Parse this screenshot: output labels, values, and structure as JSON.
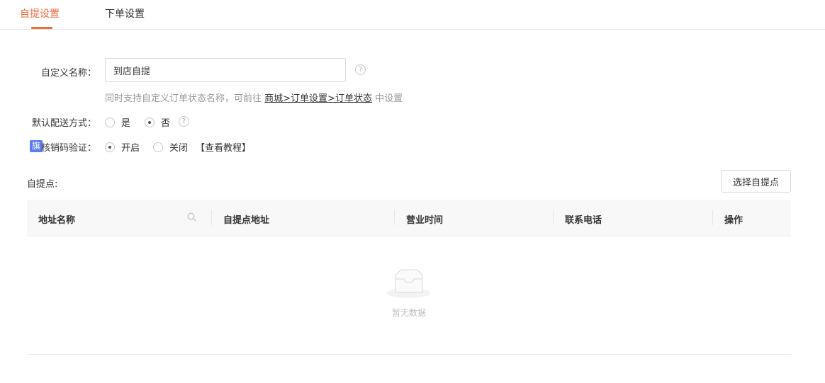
{
  "tabs": [
    {
      "label": "自提设置"
    },
    {
      "label": "下单设置"
    }
  ],
  "form": {
    "custom_name": {
      "label": "自定义名称：",
      "value": "到店自提",
      "hint_prefix": "同时支持自定义订单状态名称，可前往",
      "hint_link": "商城>订单设置>订单状态",
      "hint_suffix": "中设置"
    },
    "default_delivery": {
      "label": "默认配送方式：",
      "options": [
        {
          "label": "是",
          "checked": false
        },
        {
          "label": "否",
          "checked": true
        }
      ]
    },
    "verify": {
      "badge": "旗",
      "label": "核销码验证：",
      "options": [
        {
          "label": "开启",
          "checked": true
        },
        {
          "label": "关闭",
          "checked": false
        }
      ],
      "tutorial_link": "【查看教程】"
    }
  },
  "pickup": {
    "label": "自提点:",
    "select_button": "选择自提点",
    "columns": [
      "地址名称",
      "自提点地址",
      "营业时间",
      "联系电话",
      "操作"
    ],
    "empty_text": "暂无数据"
  },
  "icons": {
    "help": "question-icon",
    "search": "search-icon",
    "empty": "empty-box-icon"
  },
  "colors": {
    "accent": "#f06a3b",
    "badge": "#5a7cf0"
  }
}
